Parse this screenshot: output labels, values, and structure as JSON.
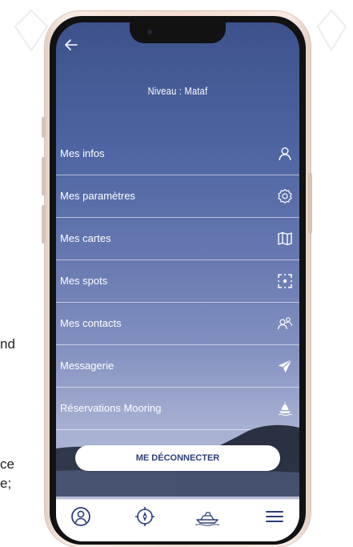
{
  "background_text": {
    "line1": "nd",
    "line2": "ce",
    "line3": "e;"
  },
  "header": {
    "level_text": "Niveau : Mataf"
  },
  "menu": [
    {
      "label": "Mes infos",
      "icon": "user-icon"
    },
    {
      "label": "Mes paramètres",
      "icon": "gear-icon"
    },
    {
      "label": "Mes cartes",
      "icon": "map-icon"
    },
    {
      "label": "Mes spots",
      "icon": "target-square-icon"
    },
    {
      "label": "Mes contacts",
      "icon": "contacts-icon"
    },
    {
      "label": "Messagerie",
      "icon": "send-icon"
    },
    {
      "label": "Réservations Mooring",
      "icon": "boat-mooring-icon"
    }
  ],
  "logout": {
    "label": "ME DÉCONNECTER"
  },
  "tabbar": {
    "tabs": [
      {
        "icon": "profile-icon"
      },
      {
        "icon": "compass-icon"
      },
      {
        "icon": "boat-icon"
      },
      {
        "icon": "hamburger-menu-icon"
      }
    ]
  },
  "colors": {
    "screen_gradient_top": "#3d528b",
    "screen_gradient_bottom": "#c4c8dd",
    "accent": "#2c3e79",
    "tab_icon": "#2c3e79"
  }
}
